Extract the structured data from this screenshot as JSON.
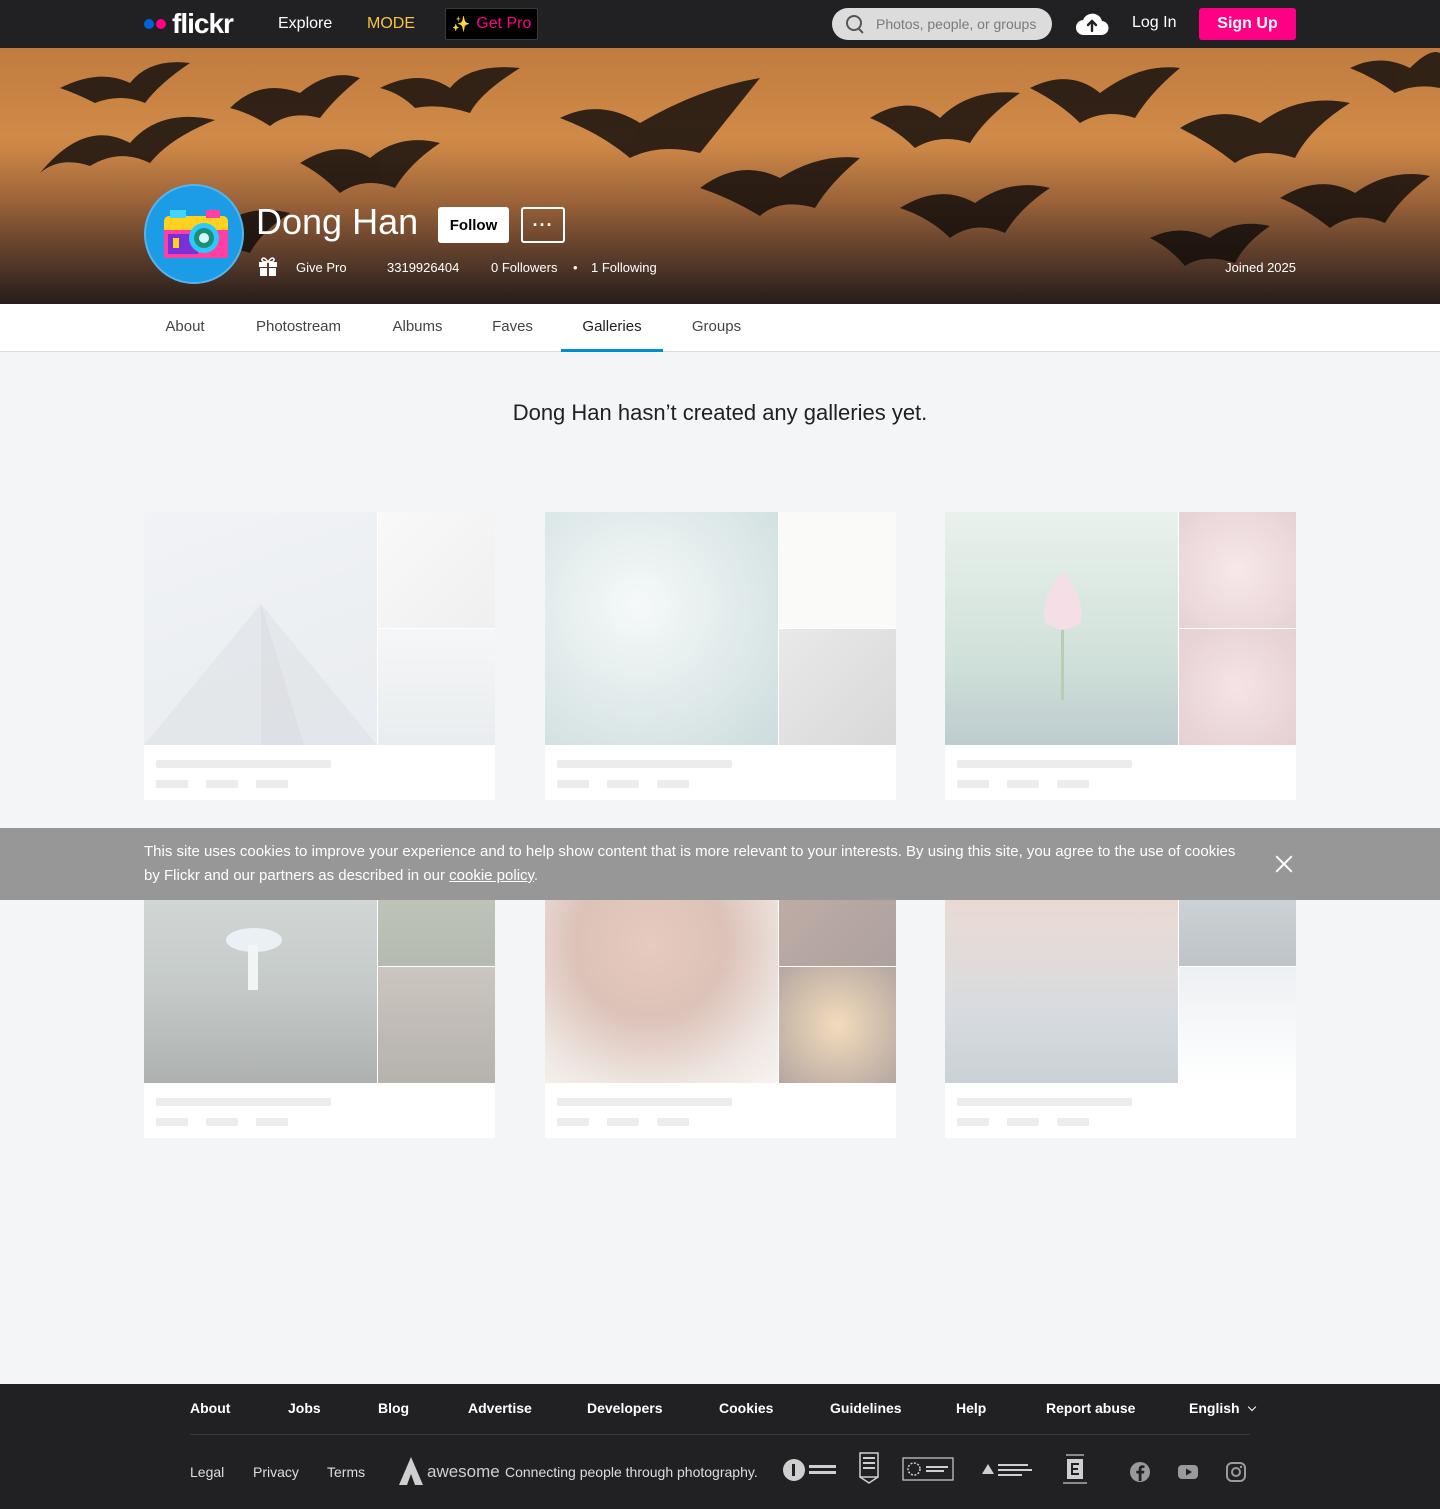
{
  "nav": {
    "logo_text": "flickr",
    "explore": "Explore",
    "mode": "MODE",
    "get_pro": "Get Pro",
    "search_placeholder": "Photos, people, or groups",
    "login": "Log In",
    "signup": "Sign Up"
  },
  "profile": {
    "name": "Dong Han",
    "follow": "Follow",
    "more": "···",
    "give_pro": "Give Pro",
    "user_id": "3319926404",
    "followers": "0 Followers",
    "dot": "•",
    "following": "1 Following",
    "joined": "Joined 2025"
  },
  "tabs": [
    {
      "label": "About"
    },
    {
      "label": "Photostream"
    },
    {
      "label": "Albums"
    },
    {
      "label": "Faves"
    },
    {
      "label": "Galleries"
    },
    {
      "label": "Groups"
    }
  ],
  "active_tab": "Galleries",
  "empty_message": "Dong Han hasn’t created any galleries yet.",
  "cookie": {
    "text": "This site uses cookies to improve your experience and to help show content that is more relevant to your interests. By using this site, you agree to the use of cookies by Flickr and our partners as described in our ",
    "link": "cookie policy",
    "end": "."
  },
  "footer": {
    "links": [
      "About",
      "Jobs",
      "Blog",
      "Advertise",
      "Developers",
      "Cookies",
      "Guidelines",
      "Help",
      "Report abuse",
      "English"
    ],
    "legal": [
      "Legal",
      "Privacy",
      "Terms"
    ],
    "brand": "awesome",
    "tagline": "Connecting people through photography."
  },
  "colors": {
    "brand_blue": "#0063dc",
    "brand_pink": "#ff0084",
    "mode_yellow": "#f6c343",
    "tab_accent": "#008ecf"
  }
}
